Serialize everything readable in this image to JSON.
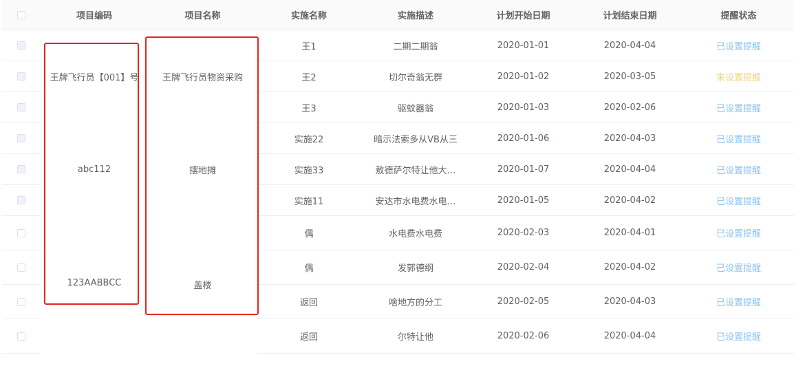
{
  "headers": {
    "project_code": "项目编码",
    "project_name": "项目名称",
    "impl_name": "实施名称",
    "impl_desc": "实施描述",
    "plan_start": "计划开始日期",
    "plan_end": "计划结束日期",
    "reminder_status": "提醒状态"
  },
  "groups": [
    {
      "code": "王牌飞行员【001】号",
      "name": "王牌飞行员物资采购"
    },
    {
      "code": "abc112",
      "name": "摆地摊"
    },
    {
      "code": "123AABBCC",
      "name": "盖楼"
    }
  ],
  "rows": [
    {
      "impl_name": "王1",
      "impl_desc": "二期二期翁",
      "start": "2020-01-01",
      "end": "2020-04-04",
      "status": "已设置提醒"
    },
    {
      "impl_name": "王2",
      "impl_desc": "切尔奇翁无群",
      "start": "2020-01-02",
      "end": "2020-03-05",
      "status": "未设置提醒"
    },
    {
      "impl_name": "王3",
      "impl_desc": "驱蚊器翁",
      "start": "2020-01-03",
      "end": "2020-02-06",
      "status": "已设置提醒"
    },
    {
      "impl_name": "实施22",
      "impl_desc": "暗示法索多从VB从三",
      "start": "2020-01-06",
      "end": "2020-04-03",
      "status": "已设置提醒"
    },
    {
      "impl_name": "实施33",
      "impl_desc": "敖德萨尔特让他大…",
      "start": "2020-01-07",
      "end": "2020-04-04",
      "status": "已设置提醒"
    },
    {
      "impl_name": "实施11",
      "impl_desc": "安达市水电费水电…",
      "start": "2020-01-05",
      "end": "2020-04-02",
      "status": "已设置提醒"
    },
    {
      "impl_name": "偶",
      "impl_desc": "水电费水电费",
      "start": "2020-02-03",
      "end": "2020-04-01",
      "status": "已设置提醒"
    },
    {
      "impl_name": "偶",
      "impl_desc": "发郭德纲",
      "start": "2020-02-04",
      "end": "2020-04-02",
      "status": "已设置提醒"
    },
    {
      "impl_name": "返回",
      "impl_desc": "啥地方的分工",
      "start": "2020-02-05",
      "end": "2020-04-03",
      "status": "已设置提醒"
    },
    {
      "impl_name": "返回",
      "impl_desc": "尔特让他",
      "start": "2020-02-06",
      "end": "2020-04-04",
      "status": "已设置提醒"
    }
  ],
  "colors": {
    "status_set": "#8ec4ef",
    "status_unset": "#f5d389",
    "highlight_box": "#e0271f",
    "header_bg": "#fafafa",
    "border": "#ebeef5"
  }
}
